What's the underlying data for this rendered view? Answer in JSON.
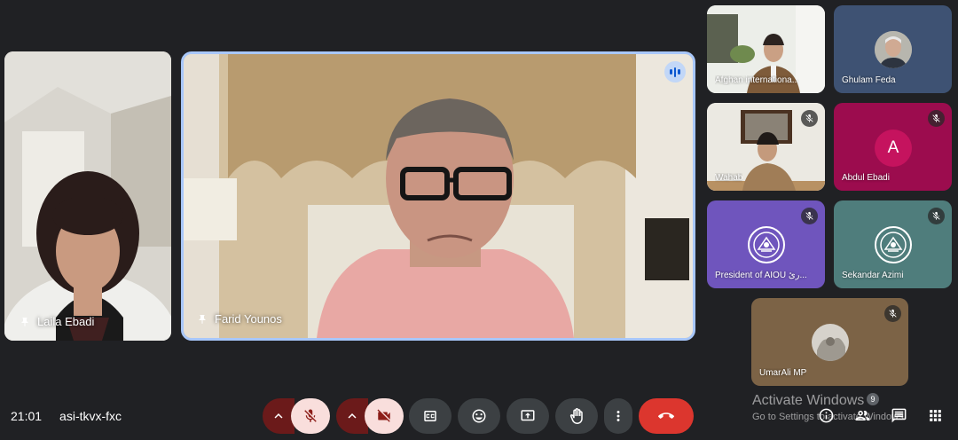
{
  "meeting": {
    "time": "21:01",
    "code": "asi-tkvx-fxc"
  },
  "main_tiles": [
    {
      "name": "Laila Ebadi"
    },
    {
      "name": "Farid Younos"
    }
  ],
  "grid_tiles": [
    {
      "name": "Afghan internationa..."
    },
    {
      "name": "Ghulam Feda"
    },
    {
      "name": "Wahab"
    },
    {
      "name": "Abdul Ebadi",
      "initial": "A"
    },
    {
      "name": "President of AIOU رئ..."
    },
    {
      "name": "Sekandar Azimi"
    },
    {
      "name": "UmarAli MP"
    }
  ],
  "windows_watermark": {
    "title": "Activate Windows",
    "subtitle": "Go to Settings to activate Windows."
  },
  "participants_count": "9",
  "colors": {
    "background": "#202124",
    "speaking_border": "#a8c7fa",
    "hangup": "#dc362e",
    "control": "#3c4043",
    "muted_control": "#f9dedc"
  }
}
